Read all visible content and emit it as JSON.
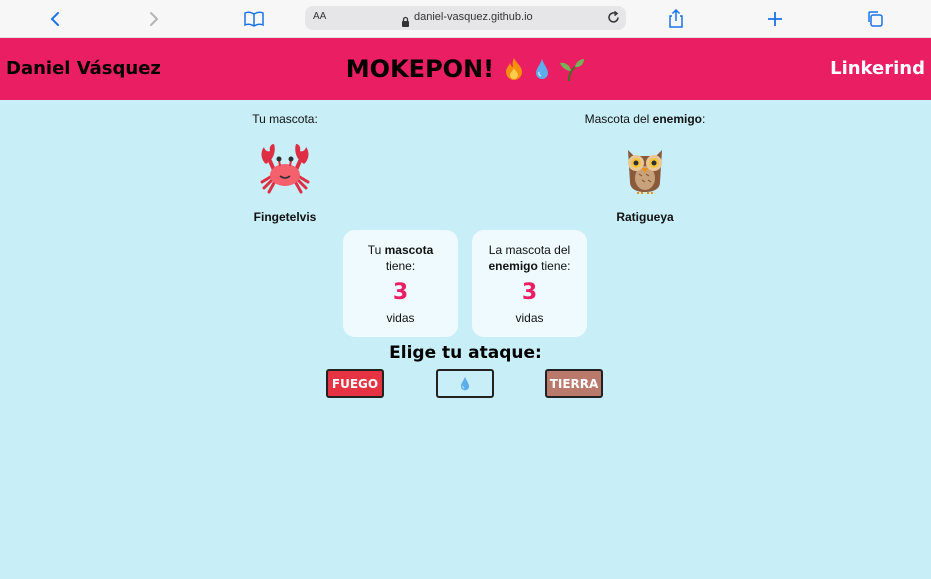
{
  "browser": {
    "aa_label": "AA",
    "url": "daniel-vasquez.github.io"
  },
  "header": {
    "author": "Daniel Vásquez",
    "title": "MOKEPON!",
    "link": "Linkerind"
  },
  "player": {
    "label": "Tu mascota:",
    "pet_name": "Fingetelvis",
    "pet_icon": "crab-icon"
  },
  "enemy": {
    "label_prefix": "Mascota del ",
    "label_bold": "enemigo",
    "label_suffix": ":",
    "pet_name": "Ratigueya",
    "pet_icon": "owl-icon"
  },
  "lives": {
    "player": {
      "prefix": "Tu ",
      "bold": "mascota",
      "suffix": " tiene:",
      "value": "3",
      "unit": "vidas"
    },
    "enemy": {
      "prefix": "La mascota del ",
      "bold": "enemigo",
      "suffix": " tiene:",
      "value": "3",
      "unit": "vidas"
    }
  },
  "attack": {
    "title": "Elige tu ataque:",
    "fire_label": "FUEGO",
    "water_icon": "water-drop-icon",
    "earth_label": "TIERRA"
  },
  "colors": {
    "header_bg": "#e91e63",
    "page_bg": "#c8eef7",
    "lives_number": "#e91e63",
    "fire_button": "#e53344",
    "earth_button": "#b97a6c"
  }
}
